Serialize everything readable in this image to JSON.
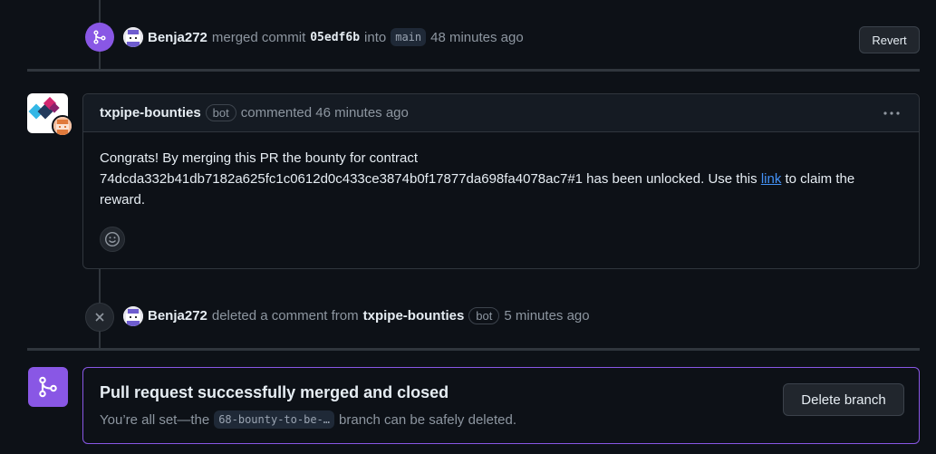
{
  "merge_event": {
    "user": "Benja272",
    "action": "merged commit",
    "commit": "05edf6b",
    "into": "into",
    "branch": "main",
    "time": "48 minutes ago",
    "revert_label": "Revert"
  },
  "comment": {
    "author": "txpipe-bounties",
    "bot_label": "bot",
    "action_time": "commented 46 minutes ago",
    "menu_icon": "kebab-horizontal-icon",
    "body_line1": "Congrats! By merging this PR the bounty for contract",
    "body_line2_pre": "74dcda332b41db7182a625fc1c0612d0c433ce3874b0f17877da698fa4078ac7#1 has been unlocked. Use this",
    "link_text": "link",
    "body_line2_post": "to claim the",
    "body_line3": "reward.",
    "reaction_icon": "smiley-icon"
  },
  "delete_event": {
    "user": "Benja272",
    "action": "deleted a comment from",
    "target": "txpipe-bounties",
    "bot_label": "bot",
    "time": "5 minutes ago"
  },
  "merged_box": {
    "title": "Pull request successfully merged and closed",
    "desc_pre": "You’re all set—the",
    "branch_chip": "68-bounty-to-be-…",
    "desc_post": "branch can be safely deleted.",
    "delete_label": "Delete branch"
  },
  "colors": {
    "merged_purple": "#8957e5",
    "link_blue": "#4493f8",
    "background": "#0d1117"
  }
}
